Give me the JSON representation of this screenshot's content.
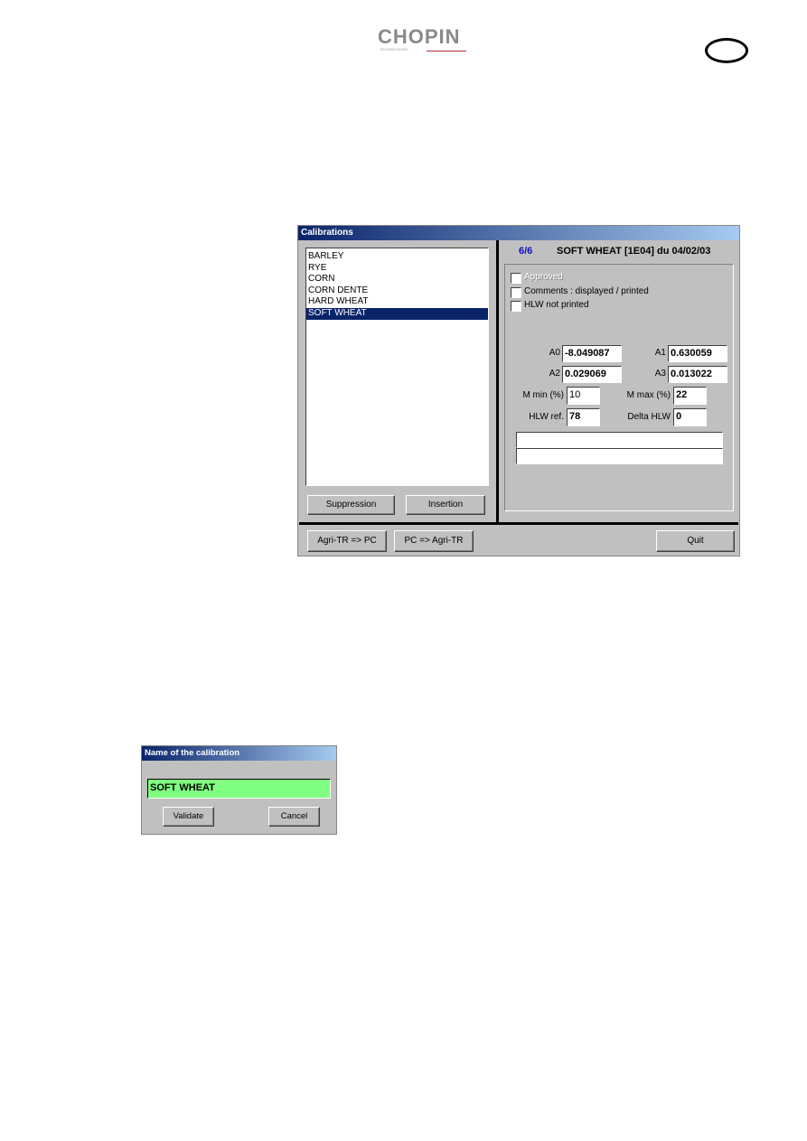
{
  "logo": {
    "text": "CHOPIN",
    "sub": "TECHNOLOGIES"
  },
  "calibrations": {
    "title": "Calibrations",
    "list": [
      "BARLEY",
      "RYE",
      "CORN",
      "CORN DENTE",
      "HARD WHEAT",
      "SOFT WHEAT"
    ],
    "selected_index": 5,
    "counter": "6/6",
    "header": "SOFT WHEAT [1E04] du 04/02/03",
    "checkboxes": [
      {
        "label": "Approved",
        "checked": false,
        "disabled": true
      },
      {
        "label": "Comments : displayed / printed",
        "checked": false
      },
      {
        "label": "HLW not printed",
        "checked": false
      }
    ],
    "fields": {
      "a0_label": "A0",
      "a0": "-8.049087",
      "a1_label": "A1",
      "a1": "0.630059",
      "a2_label": "A2",
      "a2": "0.029069",
      "a3_label": "A3",
      "a3": "0.013022",
      "mmin_label": "M min (%)",
      "mmin": "10",
      "mmax_label": "M max (%)",
      "mmax": "22",
      "hlw_label": "HLW ref.",
      "hlw": "78",
      "delta_label": "Delta HLW",
      "delta": "0"
    },
    "buttons": {
      "suppression": "Suppression",
      "insertion": "Insertion",
      "agri_to_pc": "Agri-TR => PC",
      "pc_to_agri": "PC => Agri-TR",
      "quit": "Quit"
    }
  },
  "name_dialog": {
    "title": "Name of the calibration",
    "value": "SOFT WHEAT",
    "validate": "Validate",
    "cancel": "Cancel",
    "input_color": "#80ff80"
  }
}
